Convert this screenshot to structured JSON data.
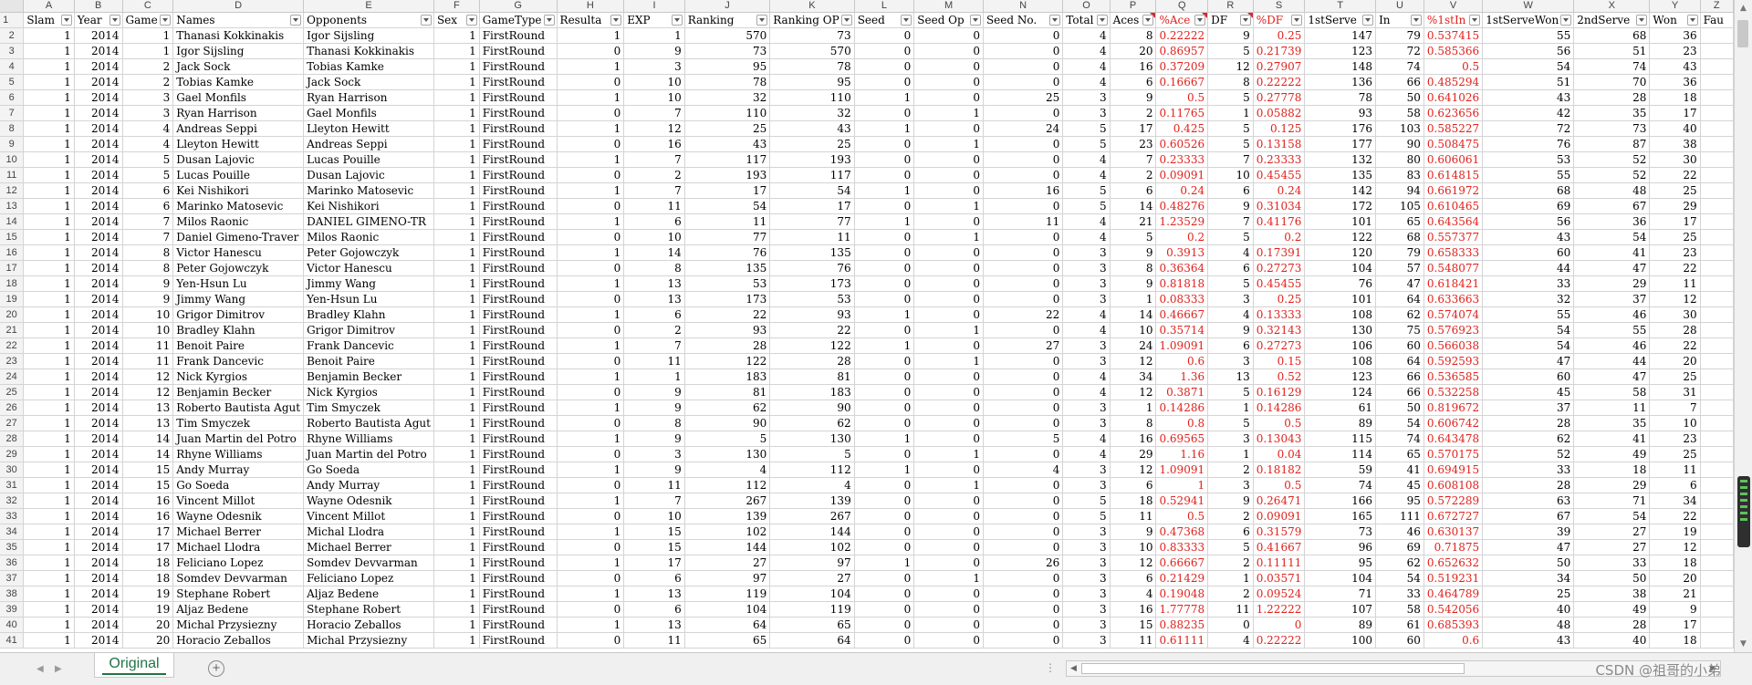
{
  "columns": [
    {
      "letter": "A",
      "width": 58,
      "header": "Slam",
      "align": "r"
    },
    {
      "letter": "B",
      "width": 56,
      "header": "Year",
      "align": "r"
    },
    {
      "letter": "C",
      "width": 56,
      "header": "Game",
      "align": "r"
    },
    {
      "letter": "D",
      "width": 118,
      "header": "Names",
      "align": "l"
    },
    {
      "letter": "E",
      "width": 124,
      "header": "Opponents",
      "align": "l"
    },
    {
      "letter": "F",
      "width": 54,
      "header": "Sex",
      "align": "r"
    },
    {
      "letter": "G",
      "width": 80,
      "header": "GameType",
      "align": "l"
    },
    {
      "letter": "H",
      "width": 78,
      "header": "Resulta",
      "align": "r"
    },
    {
      "letter": "I",
      "width": 78,
      "header": "EXP",
      "align": "r"
    },
    {
      "letter": "J",
      "width": 106,
      "header": "Ranking",
      "align": "r"
    },
    {
      "letter": "K",
      "width": 92,
      "header": "Ranking OP",
      "align": "r"
    },
    {
      "letter": "L",
      "width": 74,
      "header": "Seed",
      "align": "r"
    },
    {
      "letter": "M",
      "width": 78,
      "header": "Seed Op",
      "align": "r"
    },
    {
      "letter": "N",
      "width": 94,
      "header": "Seed No.",
      "align": "r"
    },
    {
      "letter": "O",
      "width": 52,
      "header": "Total",
      "align": "r"
    },
    {
      "letter": "P",
      "width": 52,
      "header": "Aces",
      "align": "r",
      "tri": true
    },
    {
      "letter": "Q",
      "width": 56,
      "header": "%Ace",
      "align": "r",
      "red": true,
      "tri": true
    },
    {
      "letter": "R",
      "width": 56,
      "header": "DF",
      "align": "r",
      "tri": true
    },
    {
      "letter": "S",
      "width": 56,
      "header": "%DF",
      "align": "r",
      "red": true
    },
    {
      "letter": "T",
      "width": 80,
      "header": "1stServe",
      "align": "r"
    },
    {
      "letter": "U",
      "width": 64,
      "header": "In",
      "align": "r"
    },
    {
      "letter": "V",
      "width": 64,
      "header": "%1stIn",
      "align": "r",
      "red": true
    },
    {
      "letter": "W",
      "width": 80,
      "header": "1stServeWon",
      "align": "r"
    },
    {
      "letter": "X",
      "width": 86,
      "header": "2ndServe",
      "align": "r"
    },
    {
      "letter": "Y",
      "width": 60,
      "header": "Won",
      "align": "r"
    },
    {
      "letter": "Z",
      "width": 40,
      "header": "Fau",
      "align": "r",
      "nofilter": true
    }
  ],
  "rows": [
    [
      2,
      1,
      2014,
      1,
      "Thanasi Kokkinakis",
      "Igor Sijsling",
      1,
      "FirstRound",
      1,
      1,
      570,
      73,
      0,
      0,
      0,
      4,
      8,
      "0.22222",
      9,
      "0.25",
      147,
      79,
      "0.537415",
      55,
      68,
      36
    ],
    [
      3,
      1,
      2014,
      1,
      "Igor Sijsling",
      "Thanasi Kokkinakis",
      1,
      "FirstRound",
      0,
      9,
      73,
      570,
      0,
      0,
      0,
      4,
      20,
      "0.86957",
      5,
      "0.21739",
      123,
      72,
      "0.585366",
      56,
      51,
      23
    ],
    [
      4,
      1,
      2014,
      2,
      "Jack Sock",
      "Tobias Kamke",
      1,
      "FirstRound",
      1,
      3,
      95,
      78,
      0,
      0,
      0,
      4,
      16,
      "0.37209",
      12,
      "0.27907",
      148,
      74,
      "0.5",
      54,
      74,
      43
    ],
    [
      5,
      1,
      2014,
      2,
      "Tobias Kamke",
      "Jack Sock",
      1,
      "FirstRound",
      0,
      10,
      78,
      95,
      0,
      0,
      0,
      4,
      6,
      "0.16667",
      8,
      "0.22222",
      136,
      66,
      "0.485294",
      51,
      70,
      36
    ],
    [
      6,
      1,
      2014,
      3,
      "Gael Monfils",
      "Ryan Harrison",
      1,
      "FirstRound",
      1,
      10,
      32,
      110,
      1,
      0,
      25,
      3,
      9,
      "0.5",
      5,
      "0.27778",
      78,
      50,
      "0.641026",
      43,
      28,
      18
    ],
    [
      7,
      1,
      2014,
      3,
      "Ryan Harrison",
      "Gael Monfils",
      1,
      "FirstRound",
      0,
      7,
      110,
      32,
      0,
      1,
      0,
      3,
      2,
      "0.11765",
      1,
      "0.05882",
      93,
      58,
      "0.623656",
      42,
      35,
      17
    ],
    [
      8,
      1,
      2014,
      4,
      "Andreas Seppi",
      "Lleyton Hewitt",
      1,
      "FirstRound",
      1,
      12,
      25,
      43,
      1,
      0,
      24,
      5,
      17,
      "0.425",
      5,
      "0.125",
      176,
      103,
      "0.585227",
      72,
      73,
      40
    ],
    [
      9,
      1,
      2014,
      4,
      "Lleyton Hewitt",
      "Andreas Seppi",
      1,
      "FirstRound",
      0,
      16,
      43,
      25,
      0,
      1,
      0,
      5,
      23,
      "0.60526",
      5,
      "0.13158",
      177,
      90,
      "0.508475",
      76,
      87,
      38
    ],
    [
      10,
      1,
      2014,
      5,
      "Dusan Lajovic",
      "Lucas Pouille",
      1,
      "FirstRound",
      1,
      7,
      117,
      193,
      0,
      0,
      0,
      4,
      7,
      "0.23333",
      7,
      "0.23333",
      132,
      80,
      "0.606061",
      53,
      52,
      30
    ],
    [
      11,
      1,
      2014,
      5,
      "Lucas Pouille",
      "Dusan Lajovic",
      1,
      "FirstRound",
      0,
      2,
      193,
      117,
      0,
      0,
      0,
      4,
      2,
      "0.09091",
      10,
      "0.45455",
      135,
      83,
      "0.614815",
      55,
      52,
      22
    ],
    [
      12,
      1,
      2014,
      6,
      "Kei Nishikori",
      "Marinko Matosevic",
      1,
      "FirstRound",
      1,
      7,
      17,
      54,
      1,
      0,
      16,
      5,
      6,
      "0.24",
      6,
      "0.24",
      142,
      94,
      "0.661972",
      68,
      48,
      25
    ],
    [
      13,
      1,
      2014,
      6,
      "Marinko Matosevic",
      "Kei Nishikori",
      1,
      "FirstRound",
      0,
      11,
      54,
      17,
      0,
      1,
      0,
      5,
      14,
      "0.48276",
      9,
      "0.31034",
      172,
      105,
      "0.610465",
      69,
      67,
      29
    ],
    [
      14,
      1,
      2014,
      7,
      "Milos Raonic",
      "DANIEL GIMENO-TR",
      1,
      "FirstRound",
      1,
      6,
      11,
      77,
      1,
      0,
      11,
      4,
      21,
      "1.23529",
      7,
      "0.41176",
      101,
      65,
      "0.643564",
      56,
      36,
      17
    ],
    [
      15,
      1,
      2014,
      7,
      "Daniel Gimeno-Traver",
      "Milos Raonic",
      1,
      "FirstRound",
      0,
      10,
      77,
      11,
      0,
      1,
      0,
      4,
      5,
      "0.2",
      5,
      "0.2",
      122,
      68,
      "0.557377",
      43,
      54,
      25
    ],
    [
      16,
      1,
      2014,
      8,
      "Victor Hanescu",
      "Peter Gojowczyk",
      1,
      "FirstRound",
      1,
      14,
      76,
      135,
      0,
      0,
      0,
      3,
      9,
      "0.3913",
      4,
      "0.17391",
      120,
      79,
      "0.658333",
      60,
      41,
      23
    ],
    [
      17,
      1,
      2014,
      8,
      "Peter Gojowczyk",
      "Victor Hanescu",
      1,
      "FirstRound",
      0,
      8,
      135,
      76,
      0,
      0,
      0,
      3,
      8,
      "0.36364",
      6,
      "0.27273",
      104,
      57,
      "0.548077",
      44,
      47,
      22
    ],
    [
      18,
      1,
      2014,
      9,
      "Yen-Hsun Lu",
      "Jimmy Wang",
      1,
      "FirstRound",
      1,
      13,
      53,
      173,
      0,
      0,
      0,
      3,
      9,
      "0.81818",
      5,
      "0.45455",
      76,
      47,
      "0.618421",
      33,
      29,
      11
    ],
    [
      19,
      1,
      2014,
      9,
      "Jimmy Wang",
      "Yen-Hsun Lu",
      1,
      "FirstRound",
      0,
      13,
      173,
      53,
      0,
      0,
      0,
      3,
      1,
      "0.08333",
      3,
      "0.25",
      101,
      64,
      "0.633663",
      32,
      37,
      12
    ],
    [
      20,
      1,
      2014,
      10,
      "Grigor Dimitrov",
      "Bradley Klahn",
      1,
      "FirstRound",
      1,
      6,
      22,
      93,
      1,
      0,
      22,
      4,
      14,
      "0.46667",
      4,
      "0.13333",
      108,
      62,
      "0.574074",
      55,
      46,
      30
    ],
    [
      21,
      1,
      2014,
      10,
      "Bradley Klahn",
      "Grigor Dimitrov",
      1,
      "FirstRound",
      0,
      2,
      93,
      22,
      0,
      1,
      0,
      4,
      10,
      "0.35714",
      9,
      "0.32143",
      130,
      75,
      "0.576923",
      54,
      55,
      28
    ],
    [
      22,
      1,
      2014,
      11,
      "Benoit Paire",
      "Frank Dancevic",
      1,
      "FirstRound",
      1,
      7,
      28,
      122,
      1,
      0,
      27,
      3,
      24,
      "1.09091",
      6,
      "0.27273",
      106,
      60,
      "0.566038",
      54,
      46,
      22
    ],
    [
      23,
      1,
      2014,
      11,
      "Frank Dancevic",
      "Benoit Paire",
      1,
      "FirstRound",
      0,
      11,
      122,
      28,
      0,
      1,
      0,
      3,
      12,
      "0.6",
      3,
      "0.15",
      108,
      64,
      "0.592593",
      47,
      44,
      20
    ],
    [
      24,
      1,
      2014,
      12,
      "Nick Kyrgios",
      "Benjamin Becker",
      1,
      "FirstRound",
      1,
      1,
      183,
      81,
      0,
      0,
      0,
      4,
      34,
      "1.36",
      13,
      "0.52",
      123,
      66,
      "0.536585",
      60,
      47,
      25
    ],
    [
      25,
      1,
      2014,
      12,
      "Benjamin Becker",
      "Nick Kyrgios",
      1,
      "FirstRound",
      0,
      9,
      81,
      183,
      0,
      0,
      0,
      4,
      12,
      "0.3871",
      5,
      "0.16129",
      124,
      66,
      "0.532258",
      45,
      58,
      31
    ],
    [
      26,
      1,
      2014,
      13,
      "Roberto Bautista Agut",
      "Tim Smyczek",
      1,
      "FirstRound",
      1,
      9,
      62,
      90,
      0,
      0,
      0,
      3,
      1,
      "0.14286",
      1,
      "0.14286",
      61,
      50,
      "0.819672",
      37,
      11,
      7
    ],
    [
      27,
      1,
      2014,
      13,
      "Tim Smyczek",
      "Roberto Bautista Agut",
      1,
      "FirstRound",
      0,
      8,
      90,
      62,
      0,
      0,
      0,
      3,
      8,
      "0.8",
      5,
      "0.5",
      89,
      54,
      "0.606742",
      28,
      35,
      10
    ],
    [
      28,
      1,
      2014,
      14,
      "Juan Martin del Potro",
      "Rhyne Williams",
      1,
      "FirstRound",
      1,
      9,
      5,
      130,
      1,
      0,
      5,
      4,
      16,
      "0.69565",
      3,
      "0.13043",
      115,
      74,
      "0.643478",
      62,
      41,
      23
    ],
    [
      29,
      1,
      2014,
      14,
      "Rhyne Williams",
      "Juan Martin del Potro",
      1,
      "FirstRound",
      0,
      3,
      130,
      5,
      0,
      1,
      0,
      4,
      29,
      "1.16",
      1,
      "0.04",
      114,
      65,
      "0.570175",
      52,
      49,
      25
    ],
    [
      30,
      1,
      2014,
      15,
      "Andy Murray",
      "Go Soeda",
      1,
      "FirstRound",
      1,
      9,
      4,
      112,
      1,
      0,
      4,
      3,
      12,
      "1.09091",
      2,
      "0.18182",
      59,
      41,
      "0.694915",
      33,
      18,
      11
    ],
    [
      31,
      1,
      2014,
      15,
      "Go Soeda",
      "Andy Murray",
      1,
      "FirstRound",
      0,
      11,
      112,
      4,
      0,
      1,
      0,
      3,
      6,
      "1",
      3,
      "0.5",
      74,
      45,
      "0.608108",
      28,
      29,
      6
    ],
    [
      32,
      1,
      2014,
      16,
      "Vincent Millot",
      "Wayne Odesnik",
      1,
      "FirstRound",
      1,
      7,
      267,
      139,
      0,
      0,
      0,
      5,
      18,
      "0.52941",
      9,
      "0.26471",
      166,
      95,
      "0.572289",
      63,
      71,
      34
    ],
    [
      33,
      1,
      2014,
      16,
      "Wayne Odesnik",
      "Vincent Millot",
      1,
      "FirstRound",
      0,
      10,
      139,
      267,
      0,
      0,
      0,
      5,
      11,
      "0.5",
      2,
      "0.09091",
      165,
      111,
      "0.672727",
      67,
      54,
      22
    ],
    [
      34,
      1,
      2014,
      17,
      "Michael Berrer",
      "Michal Llodra",
      1,
      "FirstRound",
      1,
      15,
      102,
      144,
      0,
      0,
      0,
      3,
      9,
      "0.47368",
      6,
      "0.31579",
      73,
      46,
      "0.630137",
      39,
      27,
      19
    ],
    [
      35,
      1,
      2014,
      17,
      "Michael Llodra",
      "Michael Berrer",
      1,
      "FirstRound",
      0,
      15,
      144,
      102,
      0,
      0,
      0,
      3,
      10,
      "0.83333",
      5,
      "0.41667",
      96,
      69,
      "0.71875",
      47,
      27,
      12
    ],
    [
      36,
      1,
      2014,
      18,
      "Feliciano Lopez",
      "Somdev Devvarman",
      1,
      "FirstRound",
      1,
      17,
      27,
      97,
      1,
      0,
      26,
      3,
      12,
      "0.66667",
      2,
      "0.11111",
      95,
      62,
      "0.652632",
      50,
      33,
      18
    ],
    [
      37,
      1,
      2014,
      18,
      "Somdev Devvarman",
      "Feliciano Lopez",
      1,
      "FirstRound",
      0,
      6,
      97,
      27,
      0,
      1,
      0,
      3,
      6,
      "0.21429",
      1,
      "0.03571",
      104,
      54,
      "0.519231",
      34,
      50,
      20
    ],
    [
      38,
      1,
      2014,
      19,
      "Stephane Robert",
      "Aljaz Bedene",
      1,
      "FirstRound",
      1,
      13,
      119,
      104,
      0,
      0,
      0,
      3,
      4,
      "0.19048",
      2,
      "0.09524",
      71,
      33,
      "0.464789",
      25,
      38,
      21
    ],
    [
      39,
      1,
      2014,
      19,
      "Aljaz Bedene",
      "Stephane Robert",
      1,
      "FirstRound",
      0,
      6,
      104,
      119,
      0,
      0,
      0,
      3,
      16,
      "1.77778",
      11,
      "1.22222",
      107,
      58,
      "0.542056",
      40,
      49,
      9
    ],
    [
      40,
      1,
      2014,
      20,
      "Michal Przysiezny",
      "Horacio Zeballos",
      1,
      "FirstRound",
      1,
      13,
      64,
      65,
      0,
      0,
      0,
      3,
      15,
      "0.88235",
      0,
      "0",
      89,
      61,
      "0.685393",
      48,
      28,
      17
    ],
    [
      41,
      1,
      2014,
      20,
      "Horacio Zeballos",
      "Michal Przysiezny",
      1,
      "FirstRound",
      0,
      11,
      65,
      64,
      0,
      0,
      0,
      3,
      11,
      "0.61111",
      4,
      "0.22222",
      100,
      60,
      "0.6",
      43,
      40,
      18
    ]
  ],
  "sheet_tab": "Original",
  "watermark": "CSDN @祖哥的小弟",
  "icons": {
    "add_sheet": "plus-circle-icon",
    "prev": "chevron-left-icon",
    "next": "chevron-right-icon"
  },
  "colors": {
    "accent": "#217346",
    "percent_text": "#e0211c",
    "header_bg": "#f3f3f3"
  }
}
